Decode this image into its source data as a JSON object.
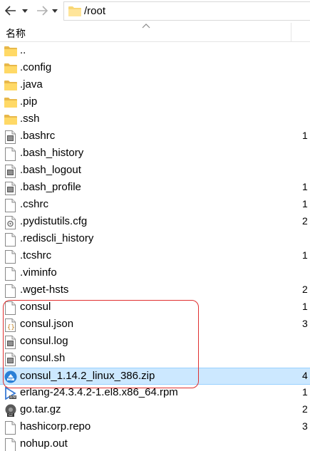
{
  "toolbar": {
    "back_icon": "arrow-left-icon",
    "forward_icon": "arrow-right-icon",
    "path": "/root"
  },
  "header": {
    "name_label": "名称"
  },
  "files": [
    {
      "name": "..",
      "type": "folder",
      "size": ""
    },
    {
      "name": ".config",
      "type": "folder",
      "size": ""
    },
    {
      "name": ".java",
      "type": "folder",
      "size": ""
    },
    {
      "name": ".pip",
      "type": "folder",
      "size": ""
    },
    {
      "name": ".ssh",
      "type": "folder",
      "size": ""
    },
    {
      "name": ".bashrc",
      "type": "text",
      "size": "1"
    },
    {
      "name": ".bash_history",
      "type": "blank",
      "size": ""
    },
    {
      "name": ".bash_logout",
      "type": "text",
      "size": ""
    },
    {
      "name": ".bash_profile",
      "type": "text",
      "size": "1"
    },
    {
      "name": ".cshrc",
      "type": "blank",
      "size": "1"
    },
    {
      "name": ".pydistutils.cfg",
      "type": "cfg",
      "size": "2"
    },
    {
      "name": ".rediscli_history",
      "type": "blank",
      "size": ""
    },
    {
      "name": ".tcshrc",
      "type": "blank",
      "size": "1"
    },
    {
      "name": ".viminfo",
      "type": "blank",
      "size": ""
    },
    {
      "name": ".wget-hsts",
      "type": "blank",
      "size": "2"
    },
    {
      "name": "consul",
      "type": "blank",
      "size": "1"
    },
    {
      "name": "consul.json",
      "type": "json",
      "size": "3"
    },
    {
      "name": "consul.log",
      "type": "text",
      "size": ""
    },
    {
      "name": "consul.sh",
      "type": "text",
      "size": ""
    },
    {
      "name": "consul_1.14.2_linux_386.zip",
      "type": "zip",
      "size": "4"
    },
    {
      "name": "erlang-24.3.4.2-1.el8.x86_64.rpm",
      "type": "rpm",
      "size": "1"
    },
    {
      "name": "go.tar.gz",
      "type": "gz",
      "size": "2"
    },
    {
      "name": "hashicorp.repo",
      "type": "blank",
      "size": "3"
    },
    {
      "name": "nohup.out",
      "type": "blank",
      "size": ""
    }
  ]
}
